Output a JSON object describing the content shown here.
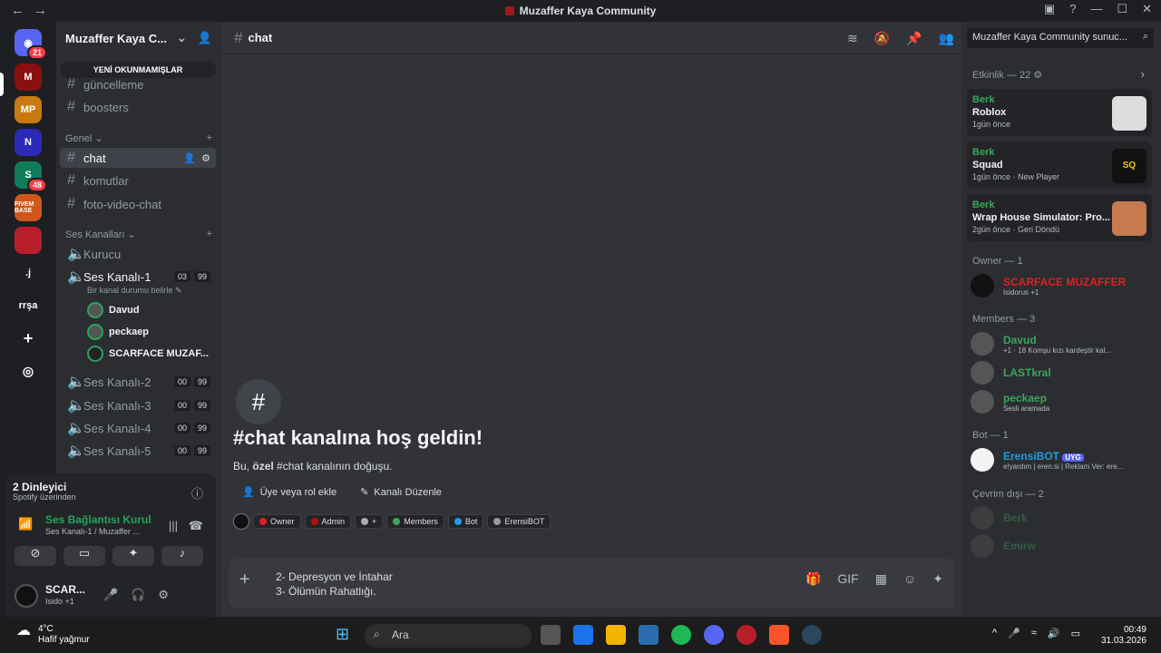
{
  "window": {
    "title": "Muzaffer Kaya Community"
  },
  "guilds": [
    {
      "label": "",
      "badge": "21"
    },
    {
      "label": "",
      "badge": ""
    },
    {
      "label": "MP",
      "badge": ""
    },
    {
      "label": "N",
      "badge": ""
    },
    {
      "label": "S",
      "badge": "48"
    },
    {
      "label": "FIVEM BASE",
      "badge": ""
    },
    {
      "label": "",
      "badge": ""
    },
    {
      "label": ".j",
      "badge": ""
    },
    {
      "label": "rrşa",
      "badge": ""
    }
  ],
  "server": {
    "name": "Muzaffer Kaya C..."
  },
  "unread_label": "YENİ OKUNMAMIŞLAR",
  "text_channels": [
    {
      "name": "güncelleme"
    },
    {
      "name": "boosters"
    }
  ],
  "category_genel": "Genel",
  "genel_channels": [
    {
      "name": "chat"
    },
    {
      "name": "komutlar"
    },
    {
      "name": "foto-video-chat"
    }
  ],
  "category_ses": "Ses Kanalları",
  "voice_channels": [
    {
      "name": "Kurucu",
      "count": "",
      "limit": ""
    },
    {
      "name": "Ses Kanalı-1",
      "count": "03",
      "limit": "99"
    },
    {
      "name": "Ses Kanalı-2",
      "count": "00",
      "limit": "99"
    },
    {
      "name": "Ses Kanalı-3",
      "count": "00",
      "limit": "99"
    },
    {
      "name": "Ses Kanalı-4",
      "count": "00",
      "limit": "99"
    },
    {
      "name": "Ses Kanalı-5",
      "count": "00",
      "limit": "99"
    }
  ],
  "voice_status_hint": "Bir kanal durumu belirle",
  "voice_users": [
    {
      "name": "Davud"
    },
    {
      "name": "peckaep"
    },
    {
      "name": "SCARFACE MUZAF..."
    }
  ],
  "spotify": {
    "listeners": "2 Dinleyici",
    "source": "Spotify üzerinden",
    "connection": "Ses Bağlantısı Kurul",
    "channel": "Ses Kanalı-1 / Muzaffer ..."
  },
  "user": {
    "name": "SCAR...",
    "status": "Isido +1"
  },
  "channel_header": {
    "name": "chat",
    "search_placeholder": "Muzaffer Kaya Community sunuc..."
  },
  "welcome": {
    "title": "#chat kanalına hoş geldin!",
    "sub_prefix": "Bu,",
    "sub_bold": "özel",
    "sub_suffix": "#chat kanalının doğuşu.",
    "add_member": "Üye veya rol ekle",
    "edit_channel": "Kanalı Düzenle"
  },
  "roles": [
    {
      "name": "Owner",
      "color": "#e02020"
    },
    {
      "name": "Admin",
      "color": "#b01010"
    },
    {
      "name": "+",
      "color": "#aaaaaa"
    },
    {
      "name": "Members",
      "color": "#3ba55c"
    },
    {
      "name": "Bot",
      "color": "#1e9de0"
    },
    {
      "name": "ErensiBOT",
      "color": "#999999"
    }
  ],
  "composer": {
    "line1": "2- Depresyon ve İntahar",
    "line2": "3- Ölümün Rahatlığı."
  },
  "members_panel": {
    "activity_header": "Etkinlik — 22",
    "activities": [
      {
        "user": "Berk",
        "game": "Roblox",
        "meta": "1gün önce"
      },
      {
        "user": "Berk",
        "game": "Squad",
        "meta": "1gün önce · New Player"
      },
      {
        "user": "Berk",
        "game": "Wrap House Simulator: Pro...",
        "meta": "2gün önce · Geri Döndü"
      }
    ],
    "owner_header": "Owner — 1",
    "owner": {
      "name": "SCARFACE MUZAFFER",
      "status": "Isidorus +1"
    },
    "members_header": "Members — 3",
    "members": [
      {
        "name": "Davud",
        "status": "+1 · 18 Komşu kızı kardeştir kal..."
      },
      {
        "name": "LASTkral",
        "status": ""
      },
      {
        "name": "peckaep",
        "status": "Sesli aramada"
      }
    ],
    "bot_header": "Bot — 1",
    "bot": {
      "name": "ErensiBOT",
      "tag": "UYG",
      "status": "e!yardım | eren.si | Reklam Ver: ere..."
    },
    "offline_header": "Çevrim dışı — 2",
    "offline": [
      {
        "name": "Berk"
      },
      {
        "name": "Emirw"
      }
    ]
  },
  "taskbar": {
    "temp": "4°C",
    "weather": "Hafif yağmur",
    "search": "Ara",
    "time": "00:49",
    "date": "31.03.2026"
  }
}
